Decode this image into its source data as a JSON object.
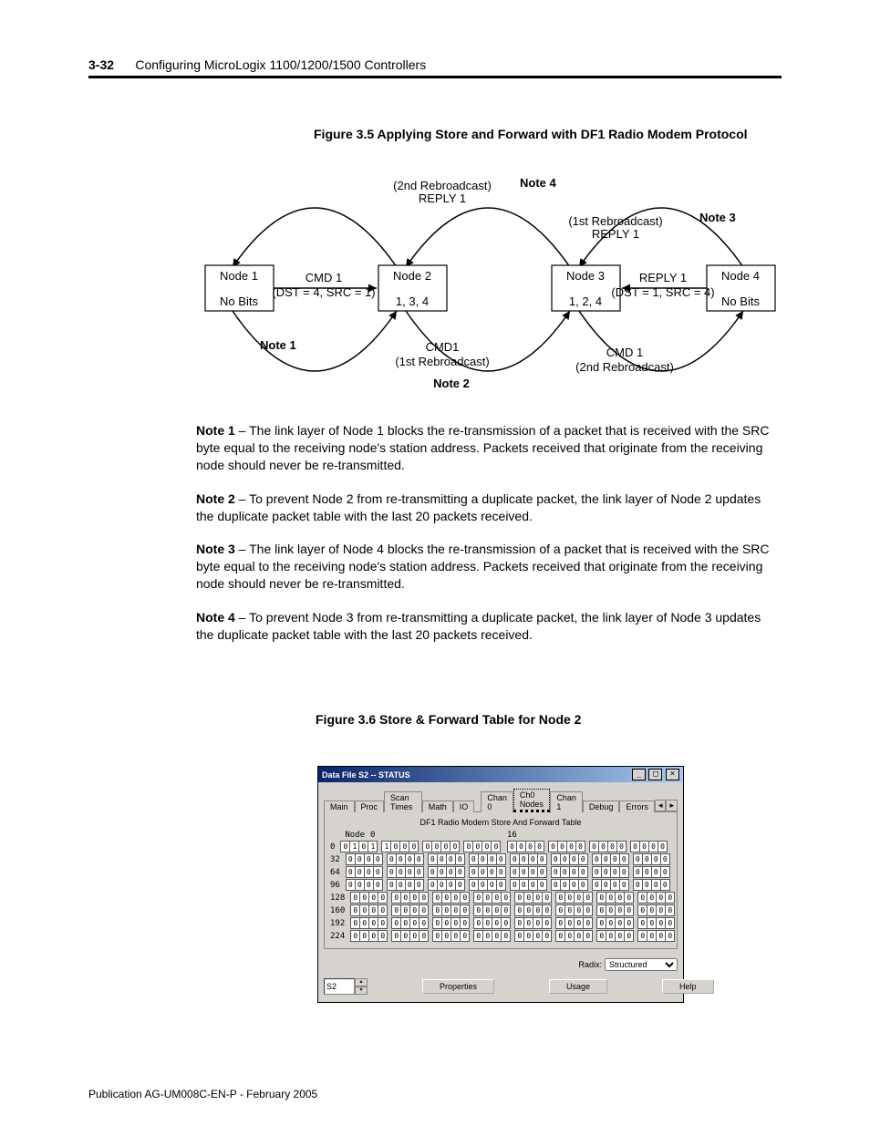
{
  "header": {
    "page_num": "3-32",
    "title": "Configuring MicroLogix 1100/1200/1500 Controllers"
  },
  "fig35": {
    "caption": "Figure 3.5 Applying Store and Forward with DF1 Radio Modem Protocol",
    "labels": {
      "rebro2_reply": "(2nd Rebroadcast)\nREPLY 1",
      "rebro1_reply": "(1st Rebroadcast)\nREPLY 1",
      "note4": "Note 4",
      "note3": "Note 3",
      "node1": "Node 1\n\nNo Bits",
      "node2": "Node 2\n\n1, 3, 4",
      "node3": "Node 3\n\n1, 2, 4",
      "node4": "Node 4\n\nNo Bits",
      "cmd1": "CMD 1\n(DST = 4, SRC = 1)",
      "reply1": "REPLY 1\n(DST = 1, SRC = 4)",
      "note1": "Note 1",
      "cmd1b": "CMD1\n(1st Rebroadcast)",
      "note2": "Note 2",
      "cmd1c": "CMD 1\n(2nd Rebroadcast)"
    }
  },
  "notes": {
    "n1b": "Note 1",
    "n1": " – The link layer of Node 1 blocks the re-transmission of a packet that is received with the SRC byte equal to the receiving node's station address. Packets received that originate from the receiving node should never be re-transmitted.",
    "n2b": "Note 2",
    "n2": " – To prevent Node 2 from re-transmitting a duplicate packet, the link layer of Node 2 updates the duplicate packet table with the last 20 packets received.",
    "n3b": "Note 3",
    "n3": " – The link layer of Node 4 blocks the re-transmission of a packet that is received with the SRC byte equal to the receiving node's station address. Packets received that originate from the receiving node should never be re-transmitted.",
    "n4b": "Note 4",
    "n4": " – To prevent Node 3 from re-transmitting a duplicate packet, the link layer of Node 3 updates the duplicate packet table with the last 20 packets received."
  },
  "fig36": {
    "caption": "Figure 3.6 Store & Forward Table for Node 2"
  },
  "window": {
    "title": "Data File S2  --  STATUS",
    "tabs": [
      "Main",
      "Proc",
      "Scan Times",
      "Math",
      "IO",
      "Chan 0",
      "Ch0 Nodes",
      "Chan 1",
      "Debug",
      "Errors"
    ],
    "subtitle": "DF1 Radio Modem Store And Forward Table",
    "node_label": "Node",
    "col0": "0",
    "col16": "16",
    "rows": [
      {
        "label": "0",
        "left": [
          [
            0,
            1,
            0,
            1
          ],
          [
            1,
            0,
            0,
            0
          ],
          [
            0,
            0,
            0,
            0
          ],
          [
            0,
            0,
            0,
            0
          ]
        ],
        "right": [
          [
            0,
            0,
            0,
            0
          ],
          [
            0,
            0,
            0,
            0
          ],
          [
            0,
            0,
            0,
            0
          ],
          [
            0,
            0,
            0,
            0
          ]
        ]
      },
      {
        "label": "32",
        "left": [
          [
            0,
            0,
            0,
            0
          ],
          [
            0,
            0,
            0,
            0
          ],
          [
            0,
            0,
            0,
            0
          ],
          [
            0,
            0,
            0,
            0
          ]
        ],
        "right": [
          [
            0,
            0,
            0,
            0
          ],
          [
            0,
            0,
            0,
            0
          ],
          [
            0,
            0,
            0,
            0
          ],
          [
            0,
            0,
            0,
            0
          ]
        ]
      },
      {
        "label": "64",
        "left": [
          [
            0,
            0,
            0,
            0
          ],
          [
            0,
            0,
            0,
            0
          ],
          [
            0,
            0,
            0,
            0
          ],
          [
            0,
            0,
            0,
            0
          ]
        ],
        "right": [
          [
            0,
            0,
            0,
            0
          ],
          [
            0,
            0,
            0,
            0
          ],
          [
            0,
            0,
            0,
            0
          ],
          [
            0,
            0,
            0,
            0
          ]
        ]
      },
      {
        "label": "96",
        "left": [
          [
            0,
            0,
            0,
            0
          ],
          [
            0,
            0,
            0,
            0
          ],
          [
            0,
            0,
            0,
            0
          ],
          [
            0,
            0,
            0,
            0
          ]
        ],
        "right": [
          [
            0,
            0,
            0,
            0
          ],
          [
            0,
            0,
            0,
            0
          ],
          [
            0,
            0,
            0,
            0
          ],
          [
            0,
            0,
            0,
            0
          ]
        ]
      },
      {
        "label": "128",
        "left": [
          [
            0,
            0,
            0,
            0
          ],
          [
            0,
            0,
            0,
            0
          ],
          [
            0,
            0,
            0,
            0
          ],
          [
            0,
            0,
            0,
            0
          ]
        ],
        "right": [
          [
            0,
            0,
            0,
            0
          ],
          [
            0,
            0,
            0,
            0
          ],
          [
            0,
            0,
            0,
            0
          ],
          [
            0,
            0,
            0,
            0
          ]
        ]
      },
      {
        "label": "160",
        "left": [
          [
            0,
            0,
            0,
            0
          ],
          [
            0,
            0,
            0,
            0
          ],
          [
            0,
            0,
            0,
            0
          ],
          [
            0,
            0,
            0,
            0
          ]
        ],
        "right": [
          [
            0,
            0,
            0,
            0
          ],
          [
            0,
            0,
            0,
            0
          ],
          [
            0,
            0,
            0,
            0
          ],
          [
            0,
            0,
            0,
            0
          ]
        ]
      },
      {
        "label": "192",
        "left": [
          [
            0,
            0,
            0,
            0
          ],
          [
            0,
            0,
            0,
            0
          ],
          [
            0,
            0,
            0,
            0
          ],
          [
            0,
            0,
            0,
            0
          ]
        ],
        "right": [
          [
            0,
            0,
            0,
            0
          ],
          [
            0,
            0,
            0,
            0
          ],
          [
            0,
            0,
            0,
            0
          ],
          [
            0,
            0,
            0,
            0
          ]
        ]
      },
      {
        "label": "224",
        "left": [
          [
            0,
            0,
            0,
            0
          ],
          [
            0,
            0,
            0,
            0
          ],
          [
            0,
            0,
            0,
            0
          ],
          [
            0,
            0,
            0,
            0
          ]
        ],
        "right": [
          [
            0,
            0,
            0,
            0
          ],
          [
            0,
            0,
            0,
            0
          ],
          [
            0,
            0,
            0,
            0
          ],
          [
            0,
            0,
            0,
            0
          ]
        ]
      }
    ],
    "radix_label": "Radix:",
    "radix_value": "Structured",
    "spin_value": "S2",
    "btn_properties": "Properties",
    "btn_usage": "Usage",
    "btn_help": "Help"
  },
  "footer": "Publication AG-UM008C-EN-P - February 2005"
}
